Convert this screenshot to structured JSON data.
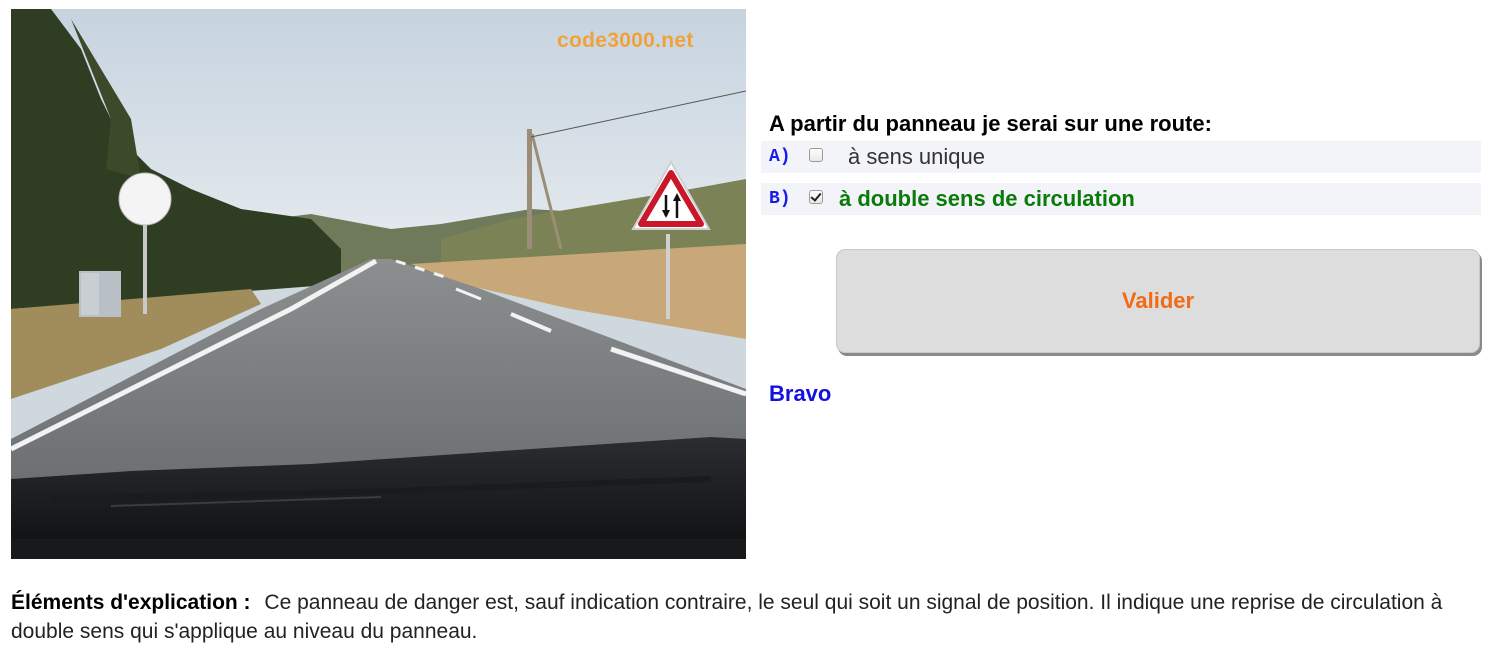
{
  "photo": {
    "watermark": "code3000.net",
    "description_alt": "Route vue depuis un véhicule avec panneau de danger"
  },
  "question": {
    "text": "A partir du panneau je serai sur une route:"
  },
  "answers": [
    {
      "letter": "A)",
      "text": "à sens unique",
      "checked": false,
      "color": "#333333"
    },
    {
      "letter": "B)",
      "text": "à double sens de circulation",
      "checked": true,
      "color": "#0a7a0a"
    }
  ],
  "actions": {
    "validate_label": "Valider"
  },
  "result": {
    "text": "Bravo",
    "color": "#1212dd"
  },
  "explanation": {
    "label": "Éléments d'explication :",
    "text": "Ce panneau de danger est, sauf indication contraire, le seul qui soit un signal de position. Il indique une reprise de circulation à double sens qui s'applique au niveau du panneau."
  },
  "colors": {
    "letter": "#1a1aee",
    "button_text": "#f26a14",
    "watermark": "#f0a23a",
    "answer_bg": "#f3f4f9"
  }
}
